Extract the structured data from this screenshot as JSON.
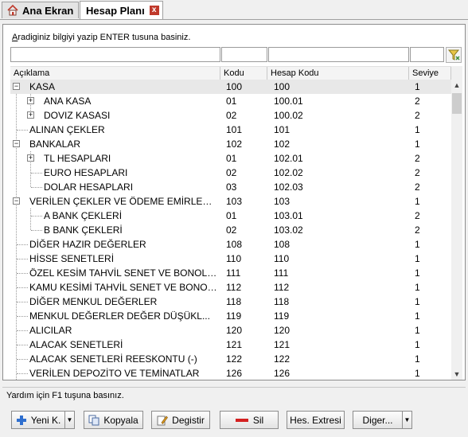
{
  "tabs": [
    {
      "label": "Ana Ekran",
      "icon": "home-icon"
    },
    {
      "label": "Hesap Planı",
      "close": "x"
    }
  ],
  "search": {
    "hint_prefix": "A",
    "hint_rest": "radiginiz bilgiyi yazip ENTER tusuna basiniz."
  },
  "columns": {
    "desc": "Açıklama",
    "kodu": "Kodu",
    "hesap_kodu": "Hesap Kodu",
    "seviye": "Seviye"
  },
  "rows": [
    {
      "desc": "KASA",
      "kodu": "100",
      "hkod": "100",
      "sev": "1"
    },
    {
      "desc": "ANA KASA",
      "kodu": "01",
      "hkod": "100.01",
      "sev": "2"
    },
    {
      "desc": "DOVIZ KASASI",
      "kodu": "02",
      "hkod": "100.02",
      "sev": "2"
    },
    {
      "desc": "ALINAN ÇEKLER",
      "kodu": "101",
      "hkod": "101",
      "sev": "1"
    },
    {
      "desc": "BANKALAR",
      "kodu": "102",
      "hkod": "102",
      "sev": "1"
    },
    {
      "desc": "TL HESAPLARI",
      "kodu": "01",
      "hkod": "102.01",
      "sev": "2"
    },
    {
      "desc": "EURO HESAPLARI",
      "kodu": "02",
      "hkod": "102.02",
      "sev": "2"
    },
    {
      "desc": "DOLAR HESAPLARI",
      "kodu": "03",
      "hkod": "102.03",
      "sev": "2"
    },
    {
      "desc": "VERİLEN ÇEKLER VE ÖDEME EMİRLERİ...",
      "kodu": "103",
      "hkod": "103",
      "sev": "1"
    },
    {
      "desc": "A BANK ÇEKLERİ",
      "kodu": "01",
      "hkod": "103.01",
      "sev": "2"
    },
    {
      "desc": "B BANK ÇEKLERİ",
      "kodu": "02",
      "hkod": "103.02",
      "sev": "2"
    },
    {
      "desc": "DİĞER HAZIR DEĞERLER",
      "kodu": "108",
      "hkod": "108",
      "sev": "1"
    },
    {
      "desc": "HİSSE SENETLERİ",
      "kodu": "110",
      "hkod": "110",
      "sev": "1"
    },
    {
      "desc": "ÖZEL KESİM TAHVİL SENET VE BONOLA...",
      "kodu": "111",
      "hkod": "111",
      "sev": "1"
    },
    {
      "desc": "KAMU KESİMİ TAHVİL SENET VE BONOL...",
      "kodu": "112",
      "hkod": "112",
      "sev": "1"
    },
    {
      "desc": "DİĞER MENKUL DEĞERLER",
      "kodu": "118",
      "hkod": "118",
      "sev": "1"
    },
    {
      "desc": "MENKUL DEĞERLER DEĞER DÜŞÜKL...",
      "kodu": "119",
      "hkod": "119",
      "sev": "1"
    },
    {
      "desc": "ALICILAR",
      "kodu": "120",
      "hkod": "120",
      "sev": "1"
    },
    {
      "desc": "ALACAK SENETLERİ",
      "kodu": "121",
      "hkod": "121",
      "sev": "1"
    },
    {
      "desc": "ALACAK SENETLERİ REESKONTU (-)",
      "kodu": "122",
      "hkod": "122",
      "sev": "1"
    },
    {
      "desc": "VERİLEN DEPOZİTO VE TEMİNATLAR",
      "kodu": "126",
      "hkod": "126",
      "sev": "1"
    }
  ],
  "status": "Yardım için F1 tuşuna basınız.",
  "buttons": {
    "new": "Yeni K.",
    "copy": "Kopyala",
    "edit": "Degistir",
    "delete": "Sil",
    "statement": "Hes. Extresi",
    "other": "Diger..."
  }
}
